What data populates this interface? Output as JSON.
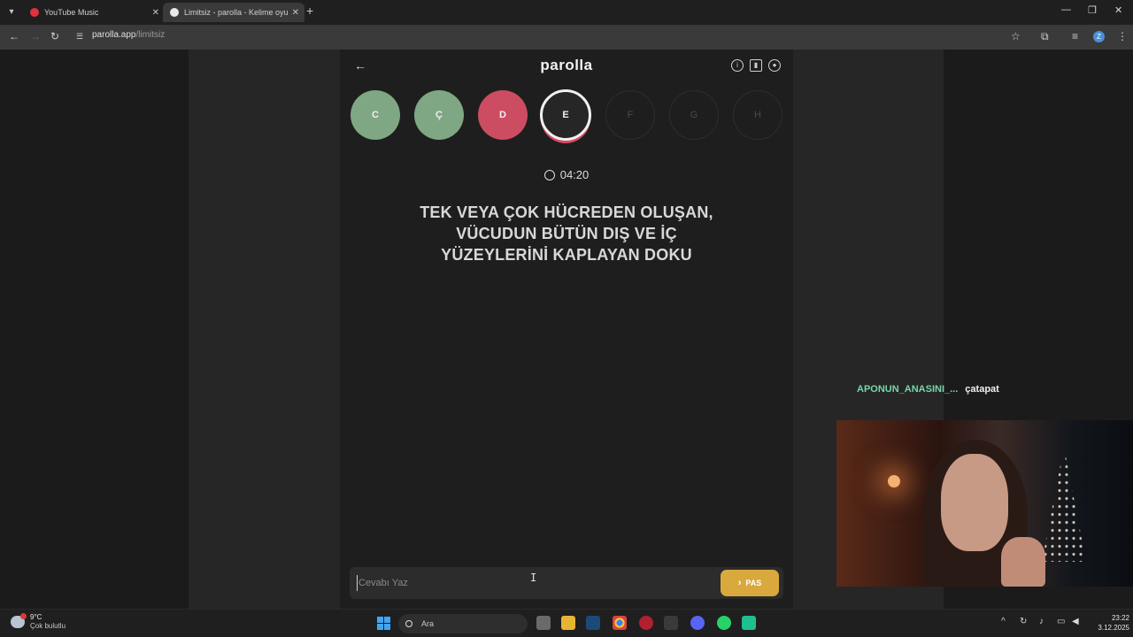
{
  "browser": {
    "tabs": [
      {
        "title": "YouTube Music",
        "active": false,
        "favicon_color": "#e5303f"
      },
      {
        "title": "Limitsiz - parolla - Kelime oyunu",
        "active": true,
        "favicon_color": "#e8e8e8"
      }
    ],
    "url_host": "parolla.app",
    "url_path": "/limitsiz",
    "profile_initial": "Z"
  },
  "game": {
    "logo": "parolla",
    "letters": [
      {
        "char": "C",
        "state": "correct"
      },
      {
        "char": "Ç",
        "state": "correct"
      },
      {
        "char": "D",
        "state": "wrong"
      },
      {
        "char": "E",
        "state": "current"
      },
      {
        "char": "F",
        "state": "pending"
      },
      {
        "char": "G",
        "state": "pending"
      },
      {
        "char": "H",
        "state": "pending"
      }
    ],
    "timer": "04:20",
    "question_lines": [
      "TEK VEYA ÇOK HÜCREDEN OLUŞAN,",
      "VÜCUDUN BÜTÜN DIŞ VE İÇ",
      "YÜZEYLERİNİ KAPLAYAN DOKU"
    ],
    "answer_placeholder": "Cevabı Yaz",
    "pass_label": "PAS"
  },
  "stream": {
    "chat_user": "APONUN_ANASINI_...",
    "chat_message": "çatapat"
  },
  "taskbar": {
    "weather_temp": "9°C",
    "weather_desc": "Çok bulutlu",
    "search_label": "Ara",
    "time": "23:22",
    "date": "3.12.2025"
  },
  "colors": {
    "correct": "#7fa783",
    "wrong": "#cc4c62",
    "pass": "#d9a93d",
    "chat_user": "#76d7a8"
  }
}
